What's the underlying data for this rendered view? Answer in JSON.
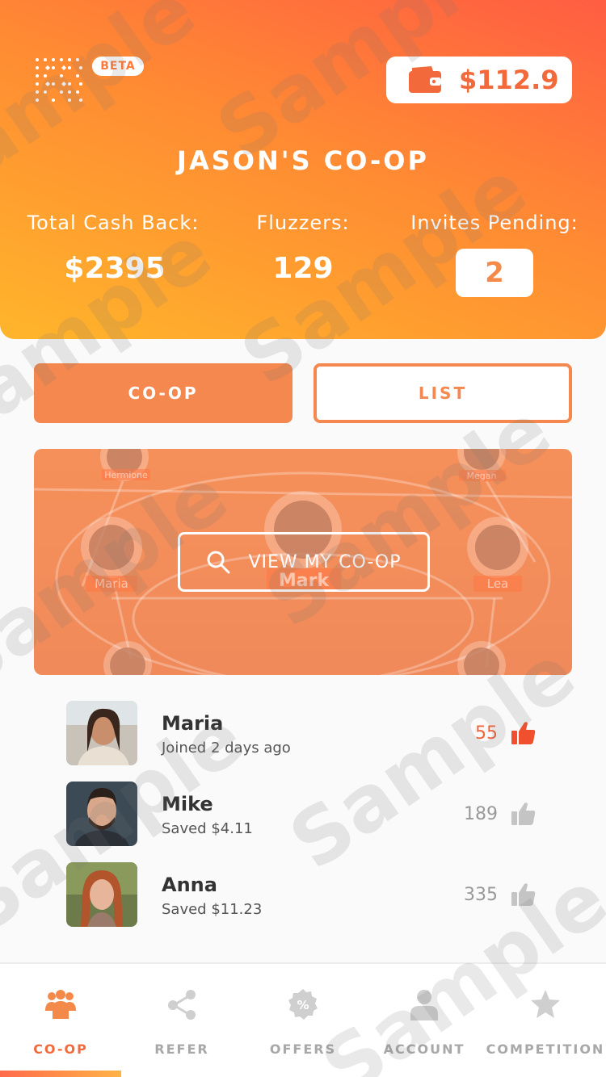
{
  "header": {
    "beta_label": "BETA",
    "wallet_amount": "$112.9",
    "title": "JASON'S CO-OP",
    "stats": {
      "cash_back_label": "Total Cash Back:",
      "cash_back_value": "$2395",
      "fluzzers_label": "Fluzzers:",
      "fluzzers_value": "129",
      "invites_label": "Invites Pending:",
      "invites_value": "2"
    }
  },
  "tabs": {
    "coop": "CO-OP",
    "list": "LIST"
  },
  "map": {
    "nodes": [
      "Hermione",
      "Megan",
      "Maria",
      "Mark",
      "Lea"
    ],
    "view_button": "VIEW MY CO-OP"
  },
  "members": [
    {
      "name": "Maria",
      "subtitle": "Joined 2 days ago",
      "count": "55",
      "liked": true
    },
    {
      "name": "Mike",
      "subtitle": "Saved $4.11",
      "count": "189",
      "liked": false
    },
    {
      "name": "Anna",
      "subtitle": "Saved $11.23",
      "count": "335",
      "liked": false
    }
  ],
  "nav": {
    "items": [
      {
        "label": "CO-OP",
        "icon": "group-icon",
        "active": true
      },
      {
        "label": "REFER",
        "icon": "share-icon",
        "active": false
      },
      {
        "label": "OFFERS",
        "icon": "percent-badge-icon",
        "active": false
      },
      {
        "label": "ACCOUNT",
        "icon": "person-icon",
        "active": false
      },
      {
        "label": "COMPETITION",
        "icon": "star-icon",
        "active": false
      }
    ]
  },
  "colors": {
    "accent": "#f26a3b",
    "accent_light": "#f4884e",
    "inactive": "#a8a8a8"
  },
  "watermark_text": "Sample"
}
